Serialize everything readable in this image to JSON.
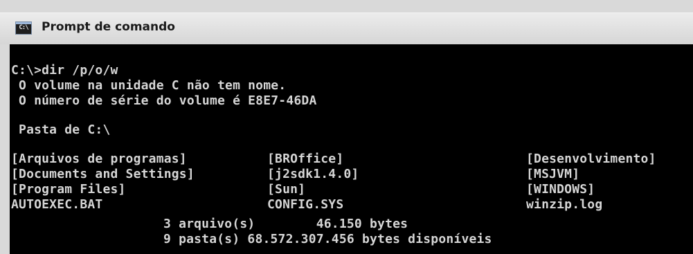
{
  "window": {
    "title": "Prompt de comando",
    "icon_label": "C:\\",
    "icon_name": "command-prompt-icon"
  },
  "console": {
    "command": "C:\\>dir /p/o/w",
    "volume_line": " O volume na unidade C não tem nome.",
    "serial_line": " O número de série do volume é E8E7-46DA",
    "folder_line": " Pasta de C:\\",
    "listing": [
      [
        "[Arquivos de programas]",
        "[BROffice]",
        "[Desenvolvimento]"
      ],
      [
        "[Documents and Settings]",
        "[j2sdk1.4.0]",
        "[MSJVM]"
      ],
      [
        "[Program Files]",
        "[Sun]",
        "[WINDOWS]"
      ],
      [
        "AUTOEXEC.BAT",
        "CONFIG.SYS",
        "winzip.log"
      ]
    ],
    "files_summary": "3 arquivo(s)        46.150 bytes",
    "dirs_summary": "9 pasta(s) 68.572.307.456 bytes disponíveis"
  },
  "colors": {
    "console_background": "#000000",
    "console_text": "#d6d6d6",
    "titlebar": "#dcdcdc"
  }
}
